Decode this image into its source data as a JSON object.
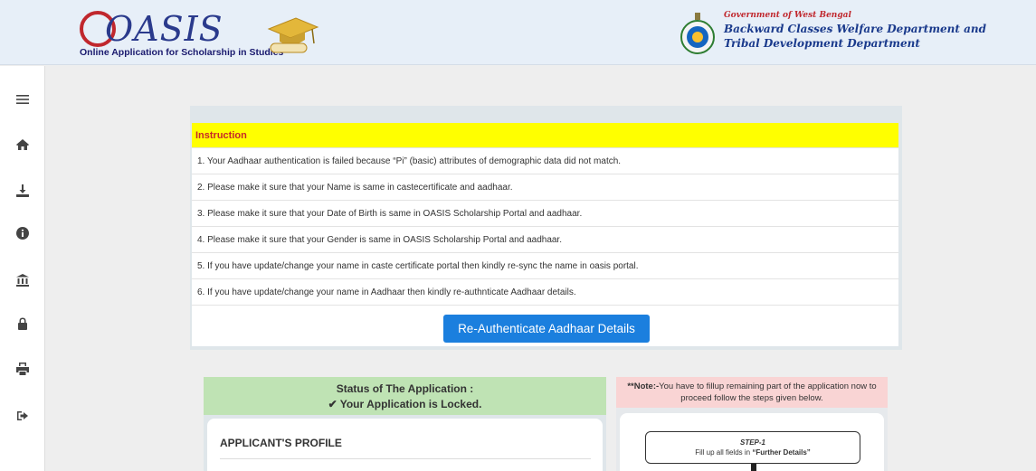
{
  "header": {
    "logo_text": "OASIS",
    "logo_subtitle": "Online Application for Scholarship in Studies",
    "gov_line1": "Government of West Bengal",
    "gov_line2": "Backward Classes Welfare Department and",
    "gov_line3": "Tribal Development Department"
  },
  "sidebar": {
    "items": [
      "menu-icon",
      "home-icon",
      "download-icon",
      "info-icon",
      "bank-icon",
      "lock-icon",
      "print-icon",
      "logout-icon"
    ]
  },
  "instructions": {
    "heading": "Instruction",
    "items": [
      "1. Your Aadhaar authentication is failed because “Pi” (basic) attributes of demographic data did not match.",
      "2. Please make it sure that your Name is same in castecertificate and aadhaar.",
      "3. Please make it sure that your Date of Birth is same in OASIS Scholarship Portal and aadhaar.",
      "4. Please make it sure that your Gender is same in OASIS Scholarship Portal and aadhaar.",
      "5. If you have update/change your name in caste certificate portal then kindly re-sync the name in oasis portal.",
      "6. If you have update/change your name in Aadhaar then kindly re-authnticate Aadhaar details."
    ],
    "button_label": "Re-Authenticate Aadhaar Details"
  },
  "status": {
    "title": "Status of The Application :",
    "message": "✔ Your Application is Locked.",
    "profile_title": "APPLICANT'S PROFILE"
  },
  "note": {
    "prefix": "**Note:-",
    "text": "You have to fillup remaining part of the application now to proceed follow the steps given below.",
    "step_label": "STEP-1",
    "step_text_pre": "Fill up all fields in ",
    "step_text_bold": "“Further Details”"
  },
  "colors": {
    "instruction_bg": "#ffff00",
    "instruction_text": "#c62828",
    "button_bg": "#1b7fde",
    "status_bg": "#bfe3b4",
    "note_bg": "#f9d4d4"
  }
}
